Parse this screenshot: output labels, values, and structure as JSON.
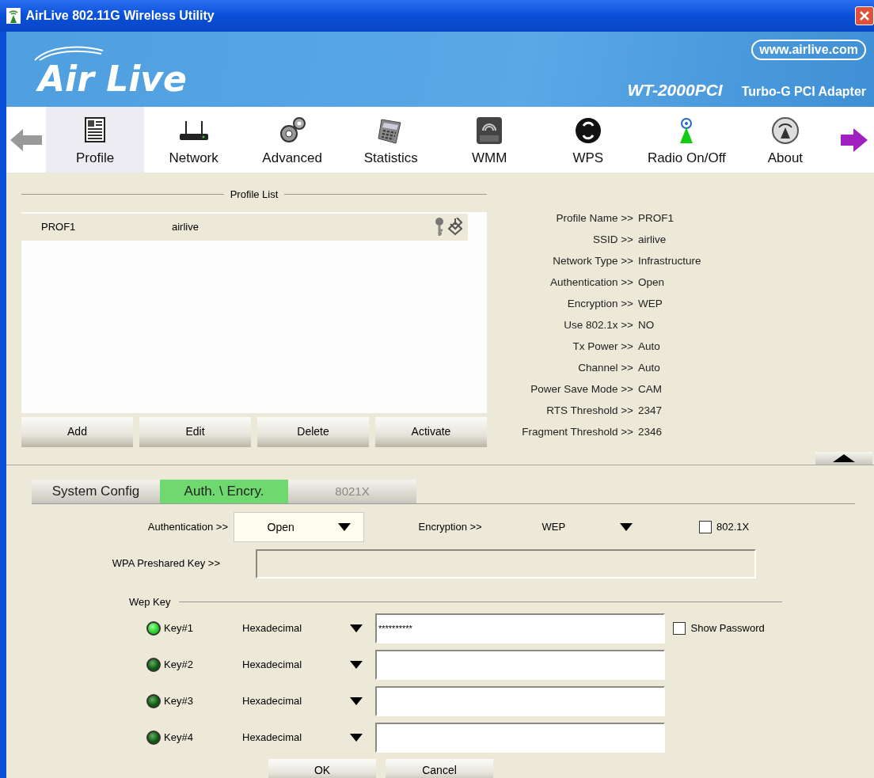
{
  "window": {
    "title": "AirLive 802.11G Wireless Utility"
  },
  "banner": {
    "logo": "Air Live",
    "url": "www.airlive.com",
    "model": "WT-2000PCI",
    "product": "Turbo-G PCI Adapter"
  },
  "toolbar": [
    {
      "label": "Profile",
      "selected": true
    },
    {
      "label": "Network",
      "selected": false
    },
    {
      "label": "Advanced",
      "selected": false
    },
    {
      "label": "Statistics",
      "selected": false
    },
    {
      "label": "WMM",
      "selected": false
    },
    {
      "label": "WPS",
      "selected": false
    },
    {
      "label": "Radio On/Off",
      "selected": false
    },
    {
      "label": "About",
      "selected": false
    }
  ],
  "profile_list": {
    "title": "Profile List",
    "rows": [
      {
        "name": "PROF1",
        "ssid": "airlive",
        "selected": true
      }
    ],
    "buttons": [
      "Add",
      "Edit",
      "Delete",
      "Activate"
    ]
  },
  "profile_details": [
    {
      "label": "Profile Name >>",
      "value": "PROF1"
    },
    {
      "label": "SSID >>",
      "value": "airlive"
    },
    {
      "label": "Network Type >>",
      "value": "Infrastructure"
    },
    {
      "label": "Authentication >>",
      "value": "Open"
    },
    {
      "label": "Encryption >>",
      "value": "WEP"
    },
    {
      "label": "Use 802.1x >>",
      "value": "NO"
    },
    {
      "label": "Tx Power >>",
      "value": "Auto"
    },
    {
      "label": "Channel >>",
      "value": "Auto"
    },
    {
      "label": "Power Save Mode >>",
      "value": "CAM"
    },
    {
      "label": "RTS Threshold >>",
      "value": "2347"
    },
    {
      "label": "Fragment Threshold >>",
      "value": "2346"
    }
  ],
  "tabs": [
    {
      "label": "System Config",
      "selected": false,
      "disabled": false
    },
    {
      "label": "Auth. \\ Encry.",
      "selected": true,
      "disabled": false
    },
    {
      "label": "8021X",
      "selected": false,
      "disabled": true
    }
  ],
  "auth": {
    "label": "Authentication >>",
    "value": "Open"
  },
  "encryption": {
    "label": "Encryption >>",
    "value": "WEP"
  },
  "ieee8021x": {
    "label": "802.1X",
    "checked": false
  },
  "wpa_key": {
    "label": "WPA Preshared Key >>"
  },
  "wep_key": {
    "title": "Wep Key",
    "show_password": {
      "label": "Show Password",
      "checked": false
    },
    "keys": [
      {
        "label": "Key#1",
        "format": "Hexadecimal",
        "value": "**********",
        "selected": true
      },
      {
        "label": "Key#2",
        "format": "Hexadecimal",
        "selected": false
      },
      {
        "label": "Key#3",
        "format": "Hexadecimal",
        "selected": false
      },
      {
        "label": "Key#4",
        "format": "Hexadecimal",
        "selected": false
      }
    ]
  },
  "buttons": [
    "OK",
    "Cancel"
  ]
}
